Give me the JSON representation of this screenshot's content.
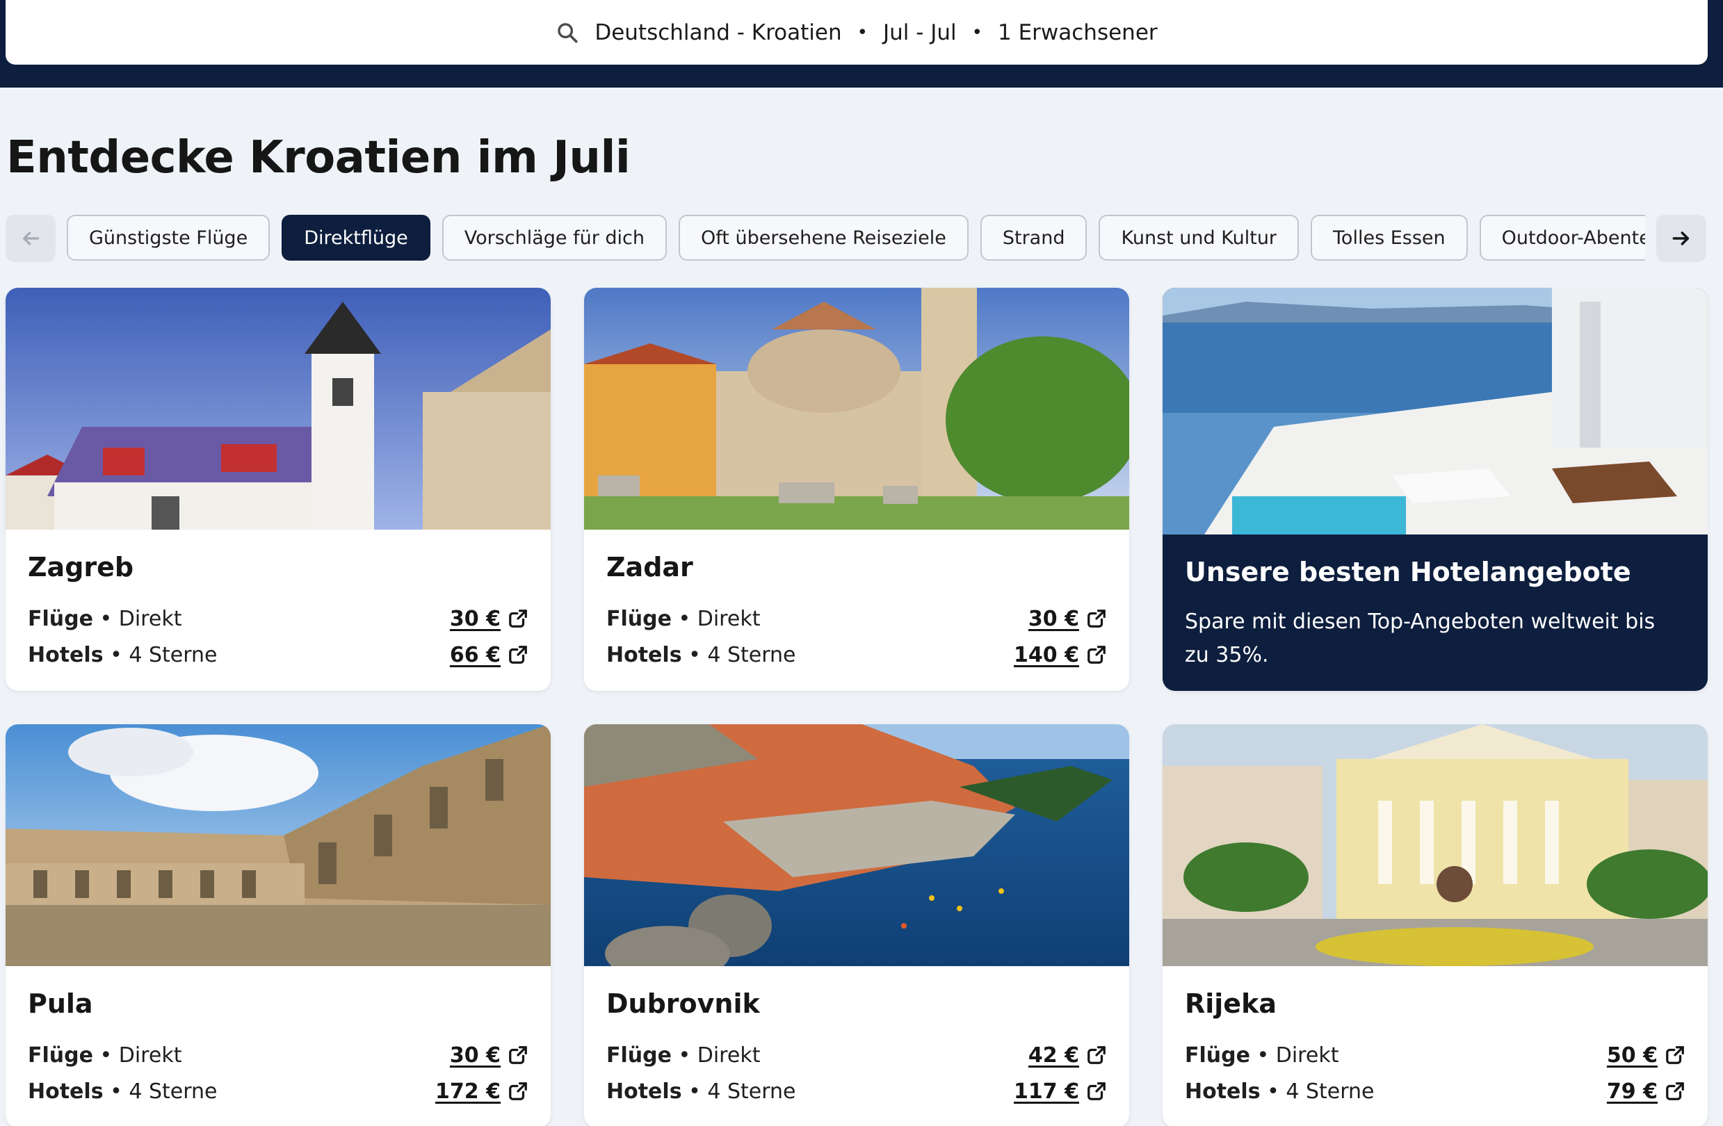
{
  "search": {
    "route": "Deutschland - Kroatien",
    "dates": "Jul - Jul",
    "travelers": "1 Erwachsener",
    "separator": "•"
  },
  "page_title": "Entdecke Kroatien im Juli",
  "chips": [
    {
      "label": "Günstigste Flüge",
      "active": false
    },
    {
      "label": "Direktflüge",
      "active": true
    },
    {
      "label": "Vorschläge für dich",
      "active": false
    },
    {
      "label": "Oft übersehene Reiseziele",
      "active": false
    },
    {
      "label": "Strand",
      "active": false
    },
    {
      "label": "Kunst und Kultur",
      "active": false
    },
    {
      "label": "Tolles Essen",
      "active": false
    },
    {
      "label": "Outdoor-Abenteuer",
      "active": false
    },
    {
      "label": "",
      "active": false
    }
  ],
  "cards": [
    {
      "city": "Zagreb",
      "flights_label": "Flüge",
      "flights_detail": "Direkt",
      "flights_price": "30 €",
      "hotels_label": "Hotels",
      "hotels_detail": "4 Sterne",
      "hotels_price": "66 €"
    },
    {
      "city": "Zadar",
      "flights_label": "Flüge",
      "flights_detail": "Direkt",
      "flights_price": "30 €",
      "hotels_label": "Hotels",
      "hotels_detail": "4 Sterne",
      "hotels_price": "140 €"
    },
    {
      "city": "Pula",
      "flights_label": "Flüge",
      "flights_detail": "Direkt",
      "flights_price": "30 €",
      "hotels_label": "Hotels",
      "hotels_detail": "4 Sterne",
      "hotels_price": "172 €"
    },
    {
      "city": "Dubrovnik",
      "flights_label": "Flüge",
      "flights_detail": "Direkt",
      "flights_price": "42 €",
      "hotels_label": "Hotels",
      "hotels_detail": "4 Sterne",
      "hotels_price": "117 €"
    },
    {
      "city": "Rijeka",
      "flights_label": "Flüge",
      "flights_detail": "Direkt",
      "flights_price": "50 €",
      "hotels_label": "Hotels",
      "hotels_detail": "4 Sterne",
      "hotels_price": "79 €"
    }
  ],
  "promo": {
    "title": "Unsere besten Hotelangebote",
    "text": "Spare mit diesen Top-Angeboten weltweit bis zu 35%."
  },
  "colors": {
    "navy": "#0d1e3e",
    "page_bg": "#eff3f8",
    "card_bg": "#ffffff"
  }
}
